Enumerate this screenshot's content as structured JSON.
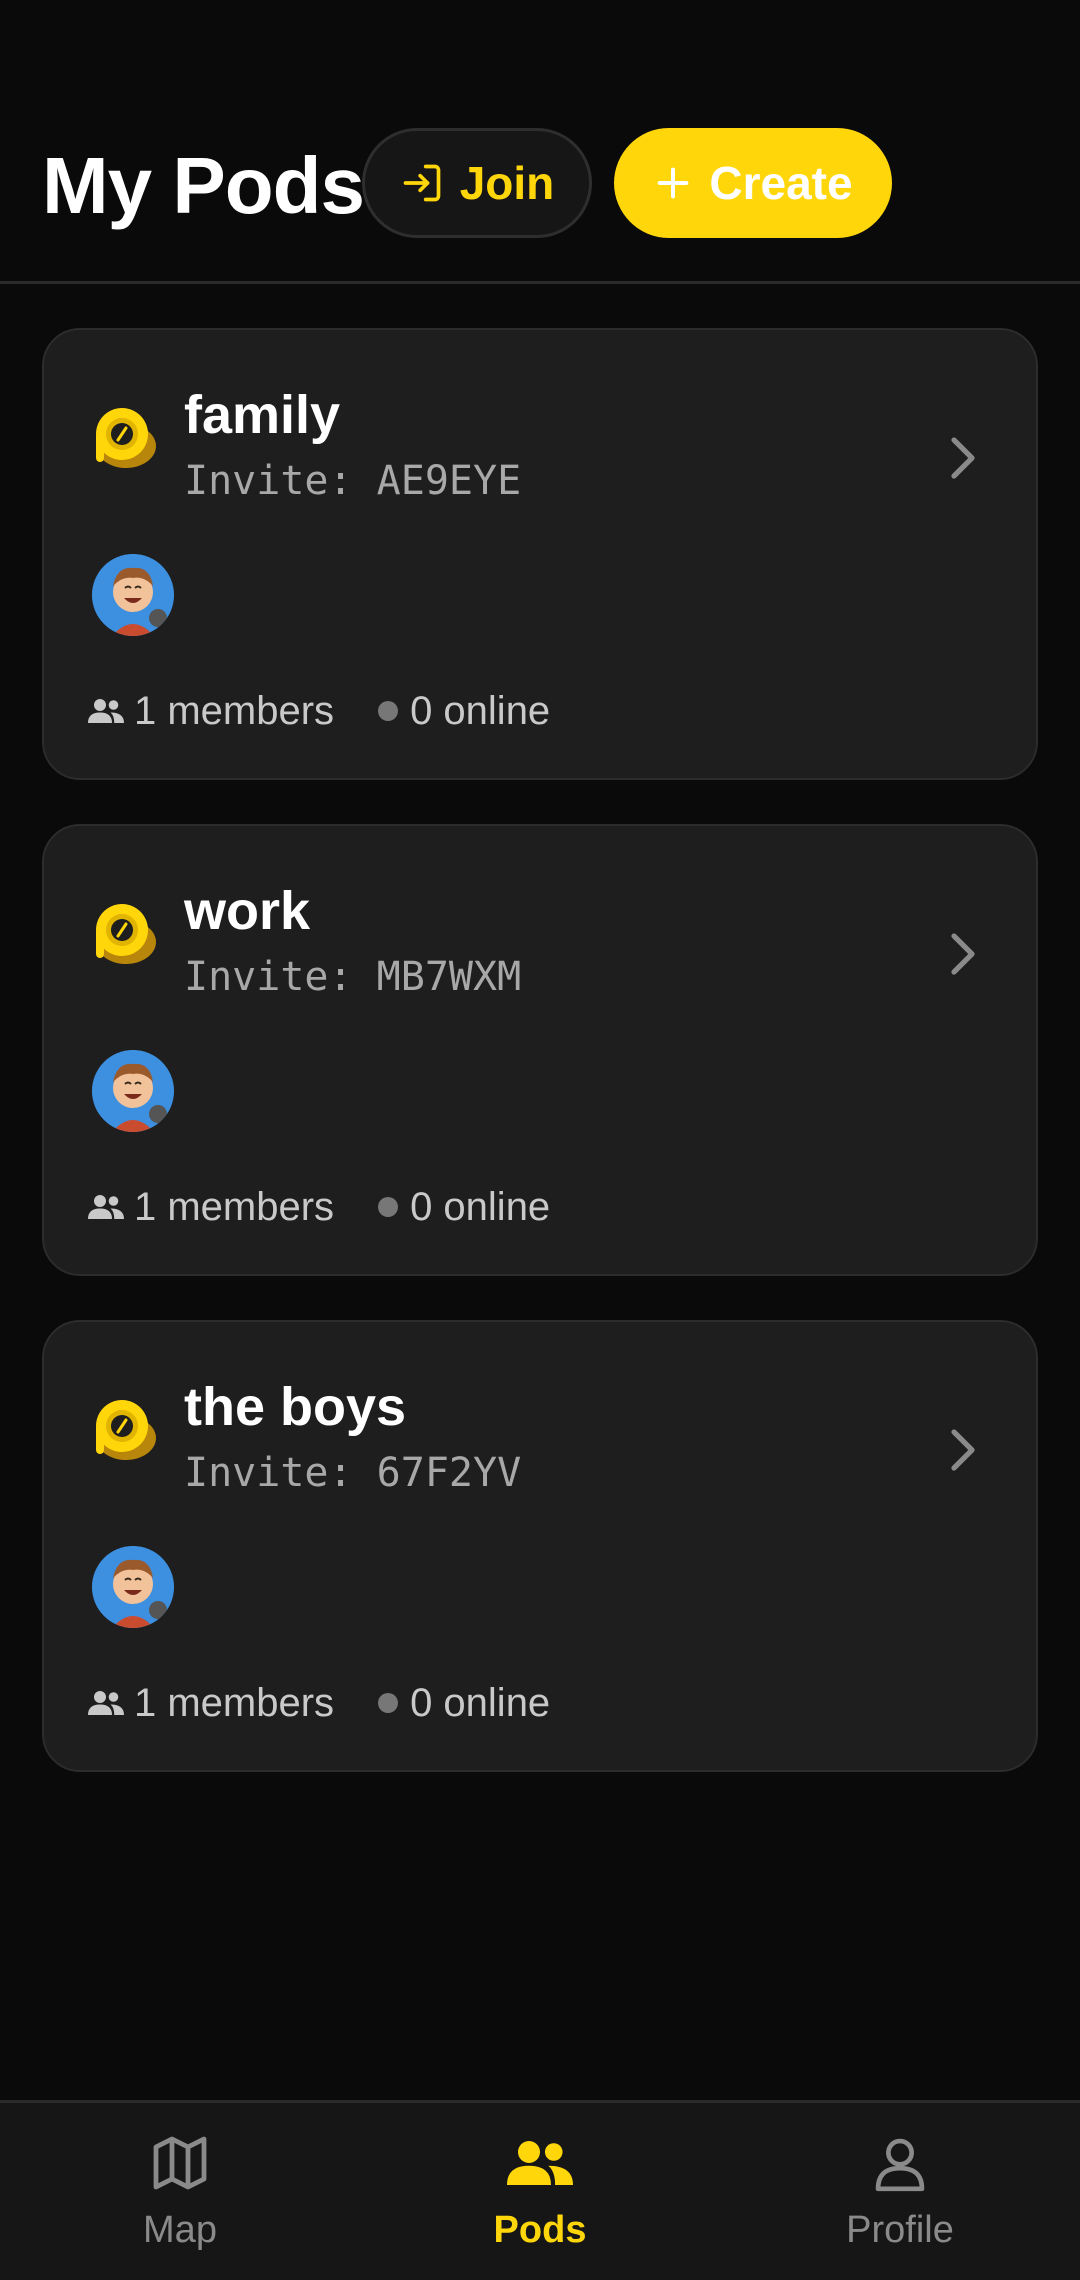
{
  "header": {
    "title": "My Pods",
    "join_label": "Join",
    "create_label": "Create"
  },
  "colors": {
    "accent": "#ffd60a",
    "background": "#0a0a0a",
    "card": "#1e1e1e"
  },
  "pods": [
    {
      "name": "family",
      "invite": "Invite: AE9EYE",
      "members": "1 members",
      "online": "0 online"
    },
    {
      "name": "work",
      "invite": "Invite: MB7WXM",
      "members": "1 members",
      "online": "0 online"
    },
    {
      "name": "the boys",
      "invite": "Invite: 67F2YV",
      "members": "1 members",
      "online": "0 online"
    }
  ],
  "nav": {
    "items": [
      {
        "label": "Map",
        "icon": "map-icon"
      },
      {
        "label": "Pods",
        "icon": "people-icon",
        "active": true
      },
      {
        "label": "Profile",
        "icon": "person-icon"
      }
    ]
  }
}
